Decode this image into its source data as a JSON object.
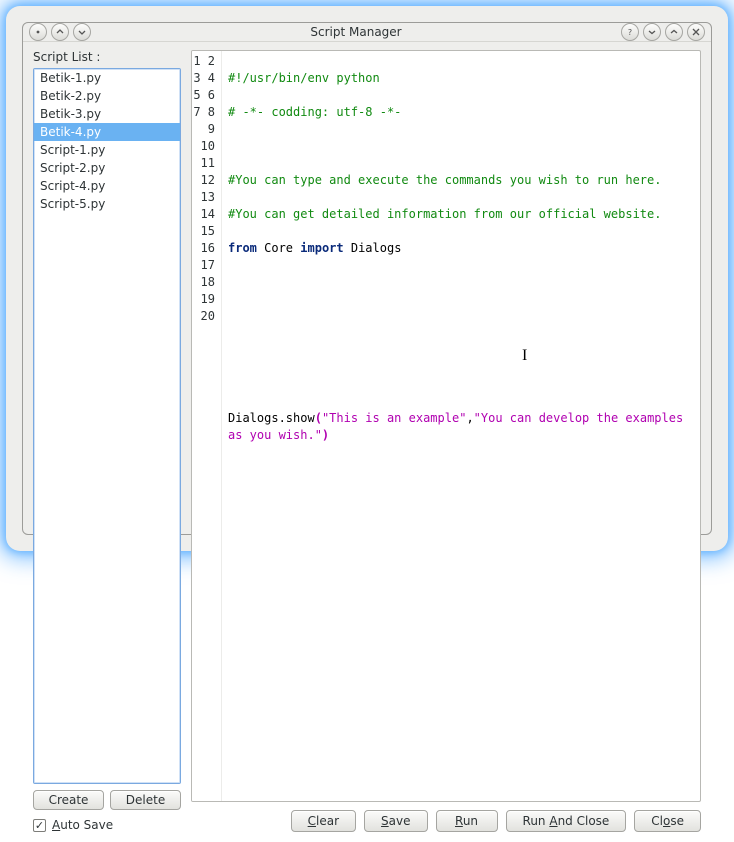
{
  "window": {
    "title": "Script Manager"
  },
  "sidebar": {
    "label": "Script List :",
    "items": [
      "Betik-1.py",
      "Betik-2.py",
      "Betik-3.py",
      "Betik-4.py",
      "Script-1.py",
      "Script-2.py",
      "Script-4.py",
      "Script-5.py"
    ],
    "selected_index": 3,
    "create_label": "Create",
    "delete_label": "Delete",
    "autosave_label": "Auto Save",
    "autosave_checked": true
  },
  "editor": {
    "line_count": 20,
    "lines": {
      "l1": "#!/usr/bin/env python",
      "l2": "# -*- codding: utf-8 -*-",
      "l4": "#You can type and execute the commands you wish to run here.",
      "l5": "#You can get detailed information from our official website.",
      "l6_from": "from",
      "l6_mod": " Core ",
      "l6_import": "import",
      "l6_name": " Dialogs",
      "l11_call": "Dialogs.show",
      "l11_p1": "(",
      "l11_s1": "\"This is an example\"",
      "l11_c": ",",
      "l11_s2": "\"You can develop the examples as you wish.\"",
      "l11_p2": ")"
    }
  },
  "buttons": {
    "clear": "Clear",
    "save": "Save",
    "run": "Run",
    "run_and_close": "Run And Close",
    "close": "Close"
  }
}
